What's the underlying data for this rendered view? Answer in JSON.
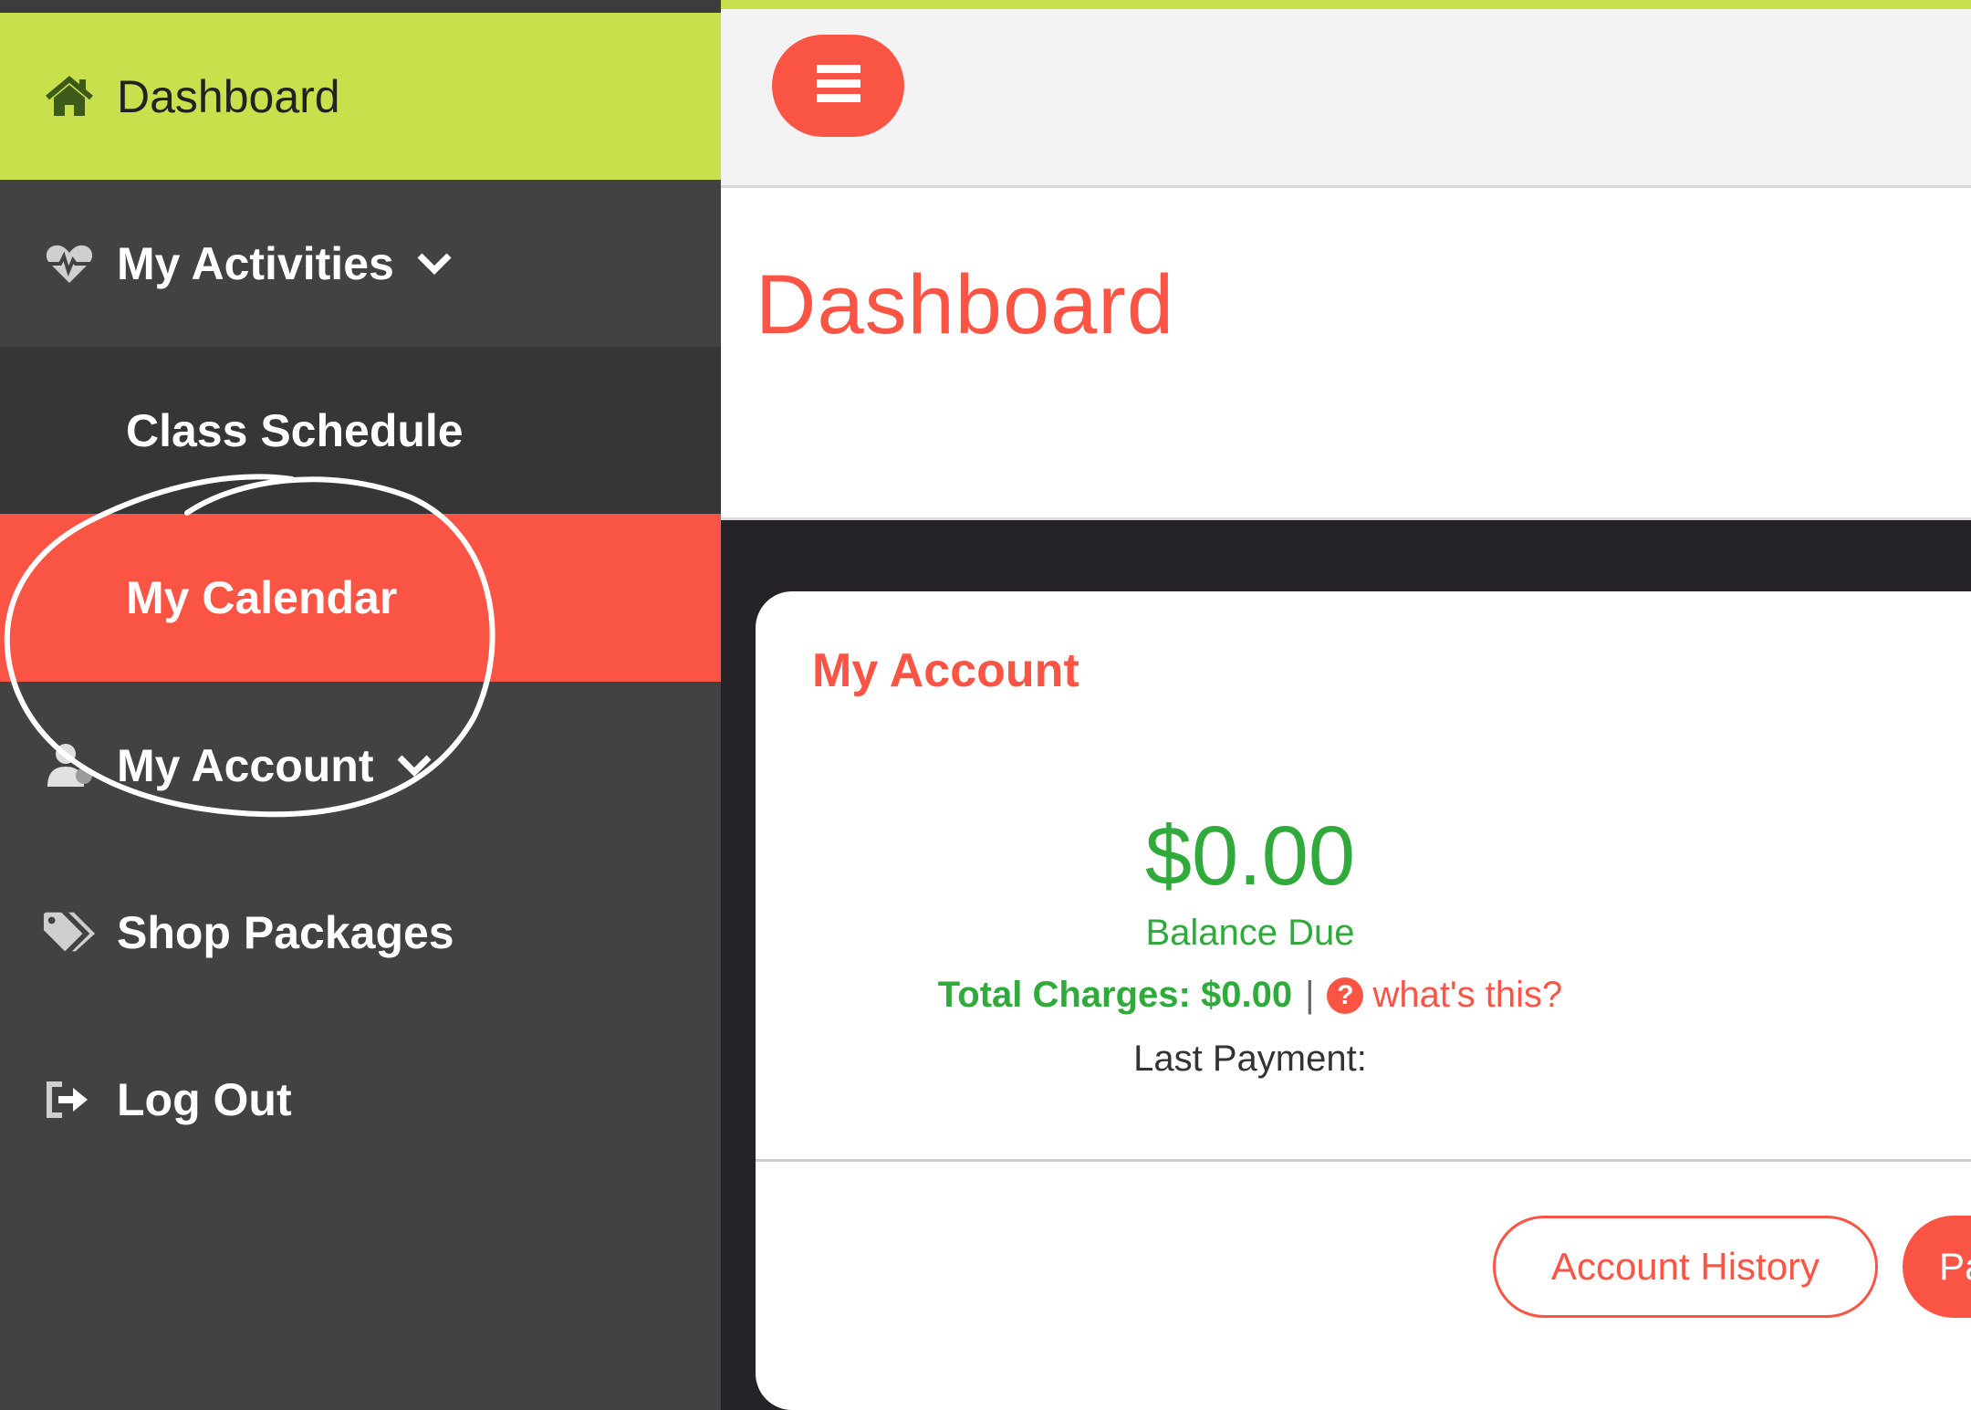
{
  "sidebar": {
    "items": [
      {
        "label": "Dashboard",
        "icon": "home-icon"
      },
      {
        "label": "My Activities",
        "icon": "heartbeat-icon"
      },
      {
        "label": "Class Schedule"
      },
      {
        "label": "My Calendar"
      },
      {
        "label": "My Account",
        "icon": "user-icon"
      },
      {
        "label": "Shop Packages",
        "icon": "tags-icon"
      },
      {
        "label": "Log Out",
        "icon": "sign-out-icon"
      }
    ],
    "active_item": "My Calendar"
  },
  "header": {
    "menu_icon": "hamburger-icon",
    "title": "Dashboard"
  },
  "account_card": {
    "title": "My Account",
    "balance": "$0.00",
    "balance_label": "Balance Due",
    "total_charges": "Total Charges: $0.00",
    "separator": "|",
    "help_glyph": "?",
    "help_link": "what's this?",
    "last_payment": "Last Payment:",
    "history_button": "Account History",
    "pay_button": "Pay"
  },
  "colors": {
    "accent_green": "#c7e04b",
    "brand_red": "#fa5445",
    "money_green": "#2faa3b",
    "sidebar_bg": "#424242"
  }
}
